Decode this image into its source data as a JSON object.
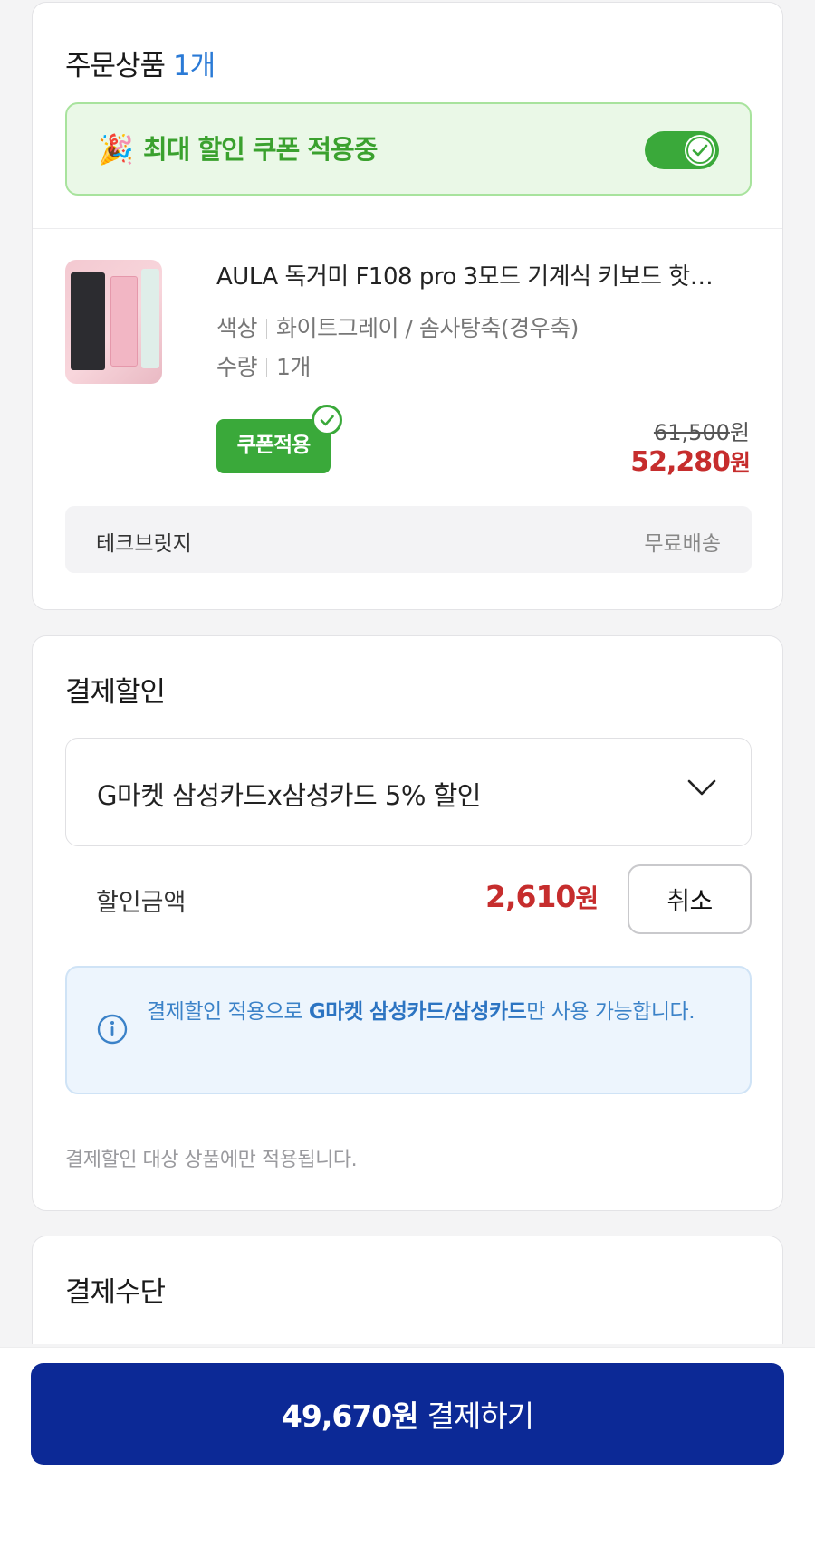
{
  "order": {
    "title": "주문상품",
    "count": "1개",
    "coupon_banner": {
      "emoji": "🎉",
      "text": "최대 할인 쿠폰 적용중",
      "toggle_on": true
    },
    "product": {
      "name": "AULA 독거미 F108 pro 3모드 기계식 키보드 핫…",
      "option_color_label": "색상",
      "option_color_value": "화이트그레이 / 솜사탕축(경우축)",
      "option_qty_label": "수량",
      "option_qty_value": "1개",
      "coupon_badge": "쿠폰적용",
      "original_price": "61,500",
      "sale_price": "52,280",
      "currency": "원"
    },
    "seller": {
      "name": "테크브릿지",
      "shipping": "무료배송"
    }
  },
  "discount": {
    "title": "결제할인",
    "selected_option": "G마켓 삼성카드x삼성카드 5% 할인",
    "amount_label": "할인금액",
    "amount_value": "2,610",
    "currency": "원",
    "cancel_label": "취소",
    "info_prefix": "결제할인 적용으로 ",
    "info_highlight": "G마켓 삼성카드/삼성카드",
    "info_suffix": "만 사용 가능합니다.",
    "note": "결제할인 대상 상품에만 적용됩니다."
  },
  "method": {
    "title": "결제수단"
  },
  "pay_button": {
    "amount": "49,670원",
    "label": "결제하기"
  },
  "colors": {
    "accent_blue": "#2a7ad6",
    "coupon_green": "#3aa93a",
    "price_red": "#c62d2d",
    "pay_button": "#0c2996"
  }
}
